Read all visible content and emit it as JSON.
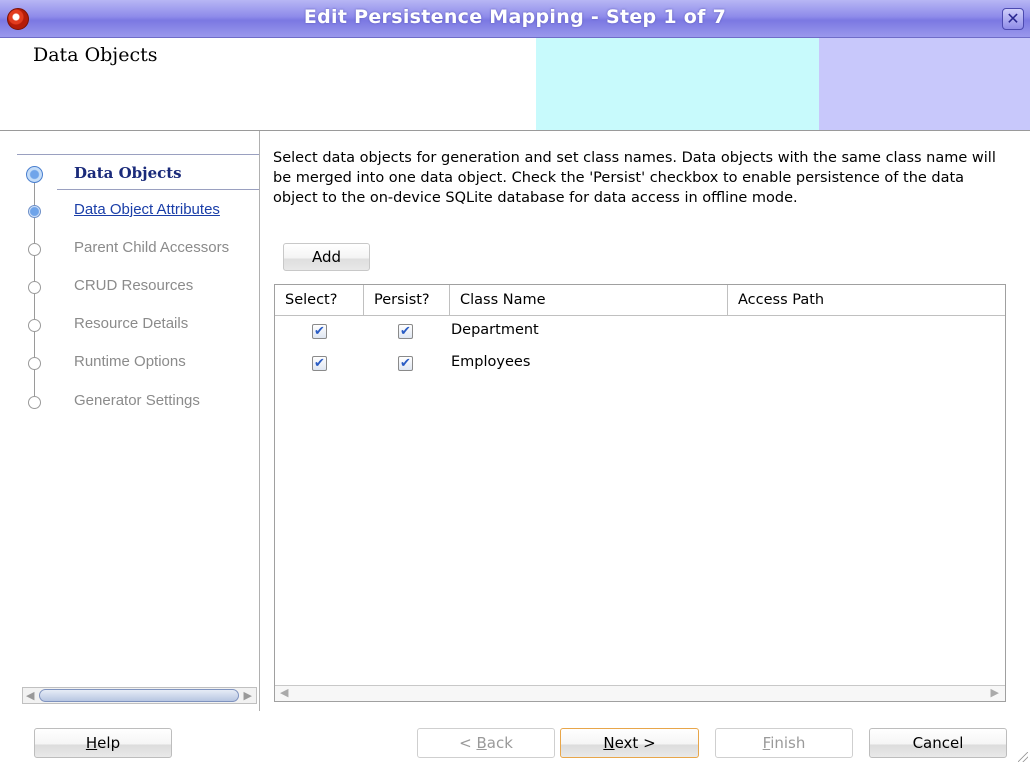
{
  "window": {
    "title": "Edit Persistence Mapping - Step 1 of 7",
    "close_glyph": "✕",
    "app_icon": "oracle-jdeveloper-icon"
  },
  "header": {
    "title": "Data Objects",
    "colors": {
      "cyan_band": "#c8fafc",
      "lavender_band": "#c8c8fb"
    }
  },
  "nav": {
    "items": [
      {
        "label": "Data Objects",
        "state": "active"
      },
      {
        "label": "Data Object Attributes",
        "state": "link"
      },
      {
        "label": "Parent Child Accessors",
        "state": "disabled"
      },
      {
        "label": "CRUD Resources",
        "state": "disabled"
      },
      {
        "label": "Resource Details",
        "state": "disabled"
      },
      {
        "label": "Runtime Options",
        "state": "disabled"
      },
      {
        "label": "Generator Settings",
        "state": "disabled"
      }
    ]
  },
  "content": {
    "description": "Select data objects for generation and set class names. Data objects with the same class name will be merged into one data object. Check the 'Persist' checkbox to enable persistence of the data object to the on-device SQLite database for data access in offline mode.",
    "add_label": "Add",
    "table": {
      "columns": [
        "Select?",
        "Persist?",
        "Class Name",
        "Access Path"
      ],
      "rows": [
        {
          "select": true,
          "persist": true,
          "class_name": "Department",
          "access_path": ""
        },
        {
          "select": true,
          "persist": true,
          "class_name": "Employees",
          "access_path": ""
        }
      ],
      "check_glyph": "✔"
    }
  },
  "footer": {
    "help": {
      "mnemonic": "H",
      "rest": "elp"
    },
    "back": {
      "prefix": "< ",
      "mnemonic": "B",
      "rest": "ack"
    },
    "next": {
      "mnemonic": "N",
      "rest": "ext >"
    },
    "finish": {
      "mnemonic": "F",
      "rest": "inish"
    },
    "cancel": "Cancel"
  },
  "scroll_arrows": {
    "left": "◀",
    "right": "▶"
  }
}
